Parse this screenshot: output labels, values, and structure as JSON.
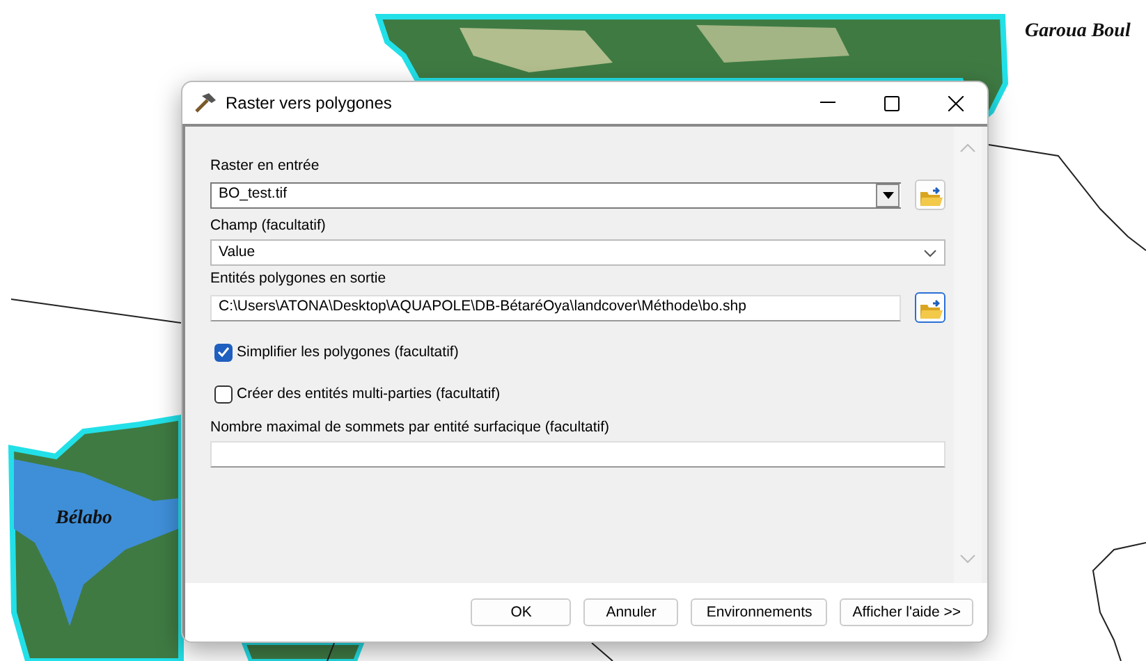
{
  "map": {
    "labels": [
      {
        "text": "Garoua Boul"
      },
      {
        "text": "Bélabo"
      }
    ]
  },
  "window": {
    "title": "Raster vers polygones"
  },
  "fields": [
    {
      "kind": "combo",
      "label": "Raster en entrée",
      "value": "BO_test.tif",
      "browse": true
    },
    {
      "kind": "dropdown",
      "label": "Champ (facultatif)",
      "value": "Value"
    },
    {
      "kind": "text",
      "label": "Entités polygones en sortie",
      "value": "C:\\Users\\ATONA\\Desktop\\AQUAPOLE\\DB-BétaréOya\\landcover\\Méthode\\bo.shp",
      "browse": true
    },
    {
      "kind": "checkbox",
      "label": "Simplifier les polygones (facultatif)",
      "checked": true
    },
    {
      "kind": "checkbox",
      "label": "Créer des entités multi-parties (facultatif)",
      "checked": false
    },
    {
      "kind": "text",
      "label": "Nombre maximal de sommets par entité surfacique (facultatif)"
    }
  ],
  "buttons": [
    "OK",
    "Annuler",
    "Environnements",
    "Afficher l'aide >>"
  ]
}
